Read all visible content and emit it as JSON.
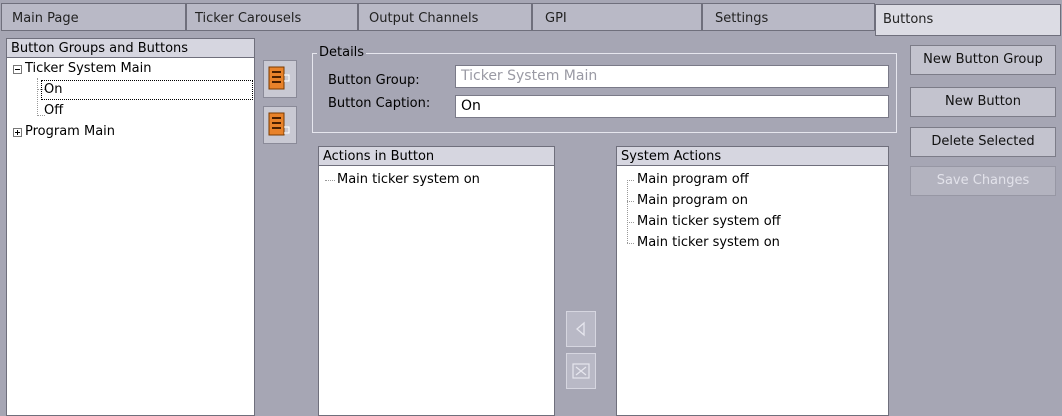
{
  "tabs": [
    {
      "label": "Main Page",
      "active": false
    },
    {
      "label": "Ticker Carousels",
      "active": false
    },
    {
      "label": "Output Channels",
      "active": false
    },
    {
      "label": "GPI",
      "active": false
    },
    {
      "label": "Settings",
      "active": false
    },
    {
      "label": "Buttons",
      "active": true
    }
  ],
  "tree": {
    "header": "Button Groups and Buttons",
    "groups": [
      {
        "label": "Ticker System Main",
        "expanded": true,
        "children": [
          "On",
          "Off"
        ]
      },
      {
        "label": "Program Main",
        "expanded": false
      }
    ],
    "selected": "On"
  },
  "move_buttons": {
    "icons": [
      "move-to-group-icon",
      "move-from-group-icon"
    ]
  },
  "details": {
    "legend": "Details",
    "group_label": "Button Group:",
    "group_value": "Ticker System Main",
    "caption_label": "Button Caption:",
    "caption_value": "On"
  },
  "actions_in_button": {
    "header": "Actions in Button",
    "items": [
      "Main ticker system on"
    ]
  },
  "system_actions": {
    "header": "System Actions",
    "items": [
      "Main program off",
      "Main program on",
      "Main ticker system off",
      "Main ticker system on"
    ]
  },
  "transfer_buttons": {
    "icons": [
      "arrow-left-icon",
      "delete-action-icon"
    ]
  },
  "commands": {
    "new_group": "New Button Group",
    "new_button": "New Button",
    "delete_selected": "Delete Selected",
    "save_changes": "Save Changes"
  },
  "colors": {
    "background": "#a6a6b4",
    "accent_orange": "#e8822a"
  }
}
